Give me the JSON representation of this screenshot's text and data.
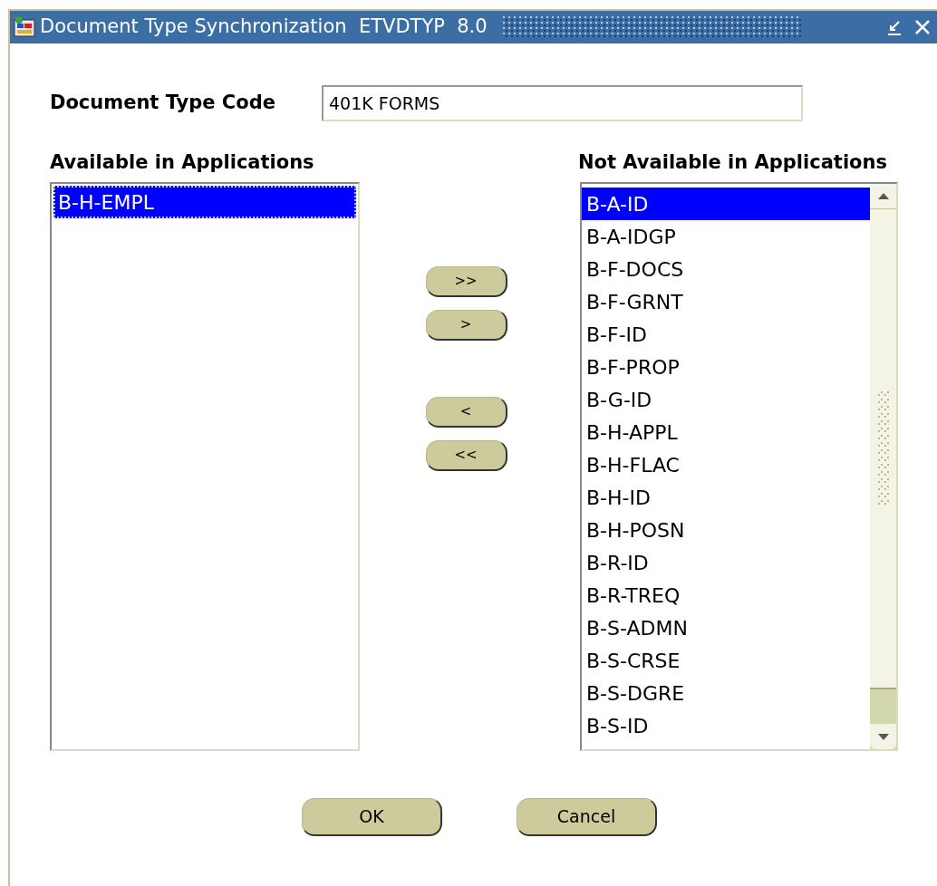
{
  "window": {
    "title": "Document Type Synchronization  ETVDTYP  8.0"
  },
  "document_type_code": {
    "label": "Document Type Code",
    "value": "401K FORMS"
  },
  "available": {
    "heading": "Available in Applications",
    "items": [
      {
        "label": "B-H-EMPL",
        "selected": true
      }
    ]
  },
  "move_buttons": [
    ">>",
    ">",
    "<",
    "<<"
  ],
  "not_available": {
    "heading": "Not Available in Applications",
    "items": [
      {
        "label": "B-A-ID",
        "selected": true
      },
      {
        "label": "B-A-IDGP",
        "selected": false
      },
      {
        "label": "B-F-DOCS",
        "selected": false
      },
      {
        "label": "B-F-GRNT",
        "selected": false
      },
      {
        "label": "B-F-ID",
        "selected": false
      },
      {
        "label": "B-F-PROP",
        "selected": false
      },
      {
        "label": "B-G-ID",
        "selected": false
      },
      {
        "label": "B-H-APPL",
        "selected": false
      },
      {
        "label": "B-H-FLAC",
        "selected": false
      },
      {
        "label": "B-H-ID",
        "selected": false
      },
      {
        "label": "B-H-POSN",
        "selected": false
      },
      {
        "label": "B-R-ID",
        "selected": false
      },
      {
        "label": "B-R-TREQ",
        "selected": false
      },
      {
        "label": "B-S-ADMN",
        "selected": false
      },
      {
        "label": "B-S-CRSE",
        "selected": false
      },
      {
        "label": "B-S-DGRE",
        "selected": false
      },
      {
        "label": "B-S-ID",
        "selected": false
      }
    ]
  },
  "buttons": [
    "OK",
    "Cancel"
  ]
}
